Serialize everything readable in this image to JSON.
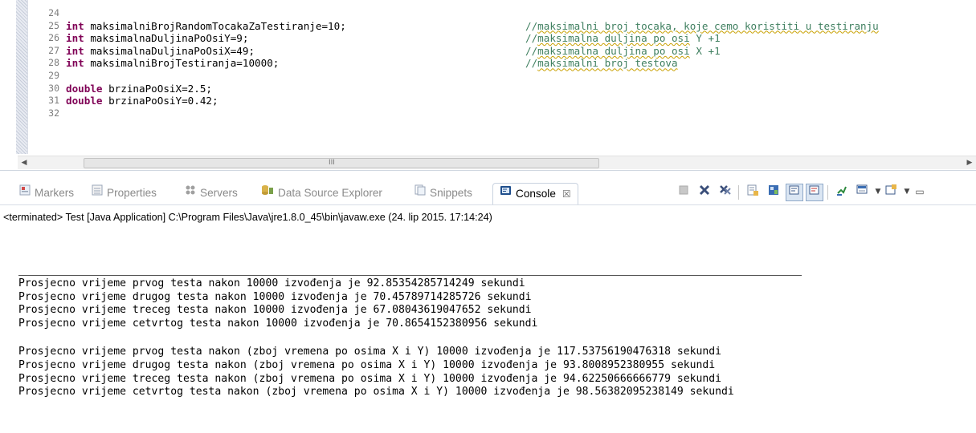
{
  "editor": {
    "line_numbers": [
      "24",
      "25",
      "26",
      "27",
      "28",
      "29",
      "30",
      "31",
      "32"
    ],
    "code_lines": [
      {
        "kw": "",
        "text": "",
        "comment": ""
      },
      {
        "kw": "int",
        "text": " maksimalniBrojRandomTocakaZaTestiranje=10;",
        "comment_prefix": "//",
        "comment_body": "maksimalni broj tocaka, koje cemo koristiti u testiranju"
      },
      {
        "kw": "int",
        "text": " maksimalnaDuljinaPoOsiY=9;",
        "comment_prefix": "//",
        "comment_body": "maksimalna duljina po osi",
        "comment_suffix": " Y +1"
      },
      {
        "kw": "int",
        "text": " maksimalnaDuljinaPoOsiX=49;",
        "comment_prefix": "//",
        "comment_body": "maksimalna duljina po osi",
        "comment_suffix": " X +1"
      },
      {
        "kw": "int",
        "text": " maksimalniBrojTestiranja=10000;",
        "comment_prefix": "//",
        "comment_body": "maksimalni broj testova"
      },
      {
        "kw": "",
        "text": "",
        "comment": ""
      },
      {
        "kw": "double",
        "text": " brzinaPoOsiX=2.5;",
        "comment": ""
      },
      {
        "kw": "double",
        "text": " brzinaPoOsiY=0.42;",
        "comment": ""
      },
      {
        "kw": "",
        "text": "",
        "comment": ""
      }
    ],
    "scrollbar_grip": "III"
  },
  "views": {
    "tabs": [
      {
        "label": "Markers",
        "icon": "markers-icon"
      },
      {
        "label": "Properties",
        "icon": "properties-icon"
      },
      {
        "label": "Servers",
        "icon": "servers-icon"
      },
      {
        "label": "Data Source Explorer",
        "icon": "data-source-explorer-icon"
      },
      {
        "label": "Snippets",
        "icon": "snippets-icon"
      },
      {
        "label": "Console",
        "icon": "console-icon",
        "close": "☒"
      }
    ]
  },
  "console": {
    "header": "<terminated> Test [Java Application] C:\\Program Files\\Java\\jre1.8.0_45\\bin\\javaw.exe (24. lip 2015. 17:14:24)",
    "output_group1": [
      "Prosjecno vrijeme prvog testa nakon 10000 izvođenja je 92.85354285714249 sekundi",
      "Prosjecno vrijeme drugog testa nakon 10000 izvođenja je 70.45789714285726 sekundi",
      "Prosjecno vrijeme treceg testa nakon 10000 izvođenja je 67.08043619047652 sekundi",
      "Prosjecno vrijeme cetvrtog testa nakon 10000 izvođenja je 70.8654152380956 sekundi"
    ],
    "output_group2": [
      "Prosjecno vrijeme prvog testa nakon (zboj vremena po osima X i Y) 10000 izvođenja je 117.53756190476318 sekundi",
      "Prosjecno vrijeme drugog testa nakon (zboj vremena po osima X i Y) 10000 izvođenja je 93.8008952380955 sekundi",
      "Prosjecno vrijeme treceg testa nakon (zboj vremena po osima X i Y) 10000 izvođenja je 94.62250666666779 sekundi",
      "Prosjecno vrijeme cetvrtog testa nakon (zboj vremena po osima X i Y) 10000 izvođenja je 98.56382095238149 sekundi"
    ]
  },
  "colors": {
    "keyword": "#7f0055",
    "comment": "#3f7f5f",
    "line_number": "#7d7d7d"
  }
}
